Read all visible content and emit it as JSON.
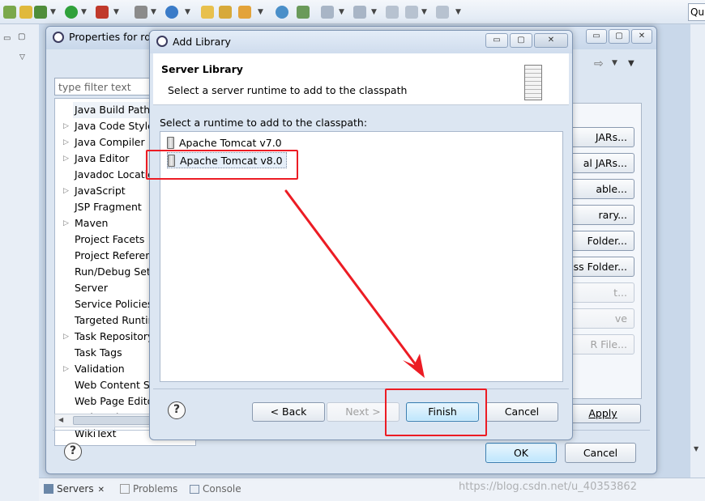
{
  "app": {
    "quick_access": "Quick Access"
  },
  "bottom_tabs": [
    {
      "label": "Servers",
      "icon": "servers-icon"
    },
    {
      "label": "Problems",
      "icon": "problems-icon"
    },
    {
      "label": "Console",
      "icon": "console-icon"
    }
  ],
  "properties": {
    "title": "Properties for rdb",
    "filter_placeholder": "type filter text",
    "tree_items": [
      {
        "label": "Java Build Path",
        "expandable": false,
        "selected": true
      },
      {
        "label": "Java Code Style",
        "expandable": true
      },
      {
        "label": "Java Compiler",
        "expandable": true
      },
      {
        "label": "Java Editor",
        "expandable": true
      },
      {
        "label": "Javadoc Location",
        "expandable": false
      },
      {
        "label": "JavaScript",
        "expandable": true
      },
      {
        "label": "JSP Fragment",
        "expandable": false
      },
      {
        "label": "Maven",
        "expandable": true
      },
      {
        "label": "Project Facets",
        "expandable": false
      },
      {
        "label": "Project References",
        "expandable": false
      },
      {
        "label": "Run/Debug Settings",
        "expandable": false
      },
      {
        "label": "Server",
        "expandable": false
      },
      {
        "label": "Service Policies",
        "expandable": false
      },
      {
        "label": "Targeted Runtimes",
        "expandable": false
      },
      {
        "label": "Task Repository",
        "expandable": true
      },
      {
        "label": "Task Tags",
        "expandable": false
      },
      {
        "label": "Validation",
        "expandable": true
      },
      {
        "label": "Web Content Settings",
        "expandable": false
      },
      {
        "label": "Web Page Editor",
        "expandable": false
      },
      {
        "label": "Web Project Settings",
        "expandable": false
      },
      {
        "label": "WikiText",
        "expandable": false
      }
    ],
    "right_buttons": [
      {
        "label": "JARs...",
        "enabled": true
      },
      {
        "label": "al JARs...",
        "enabled": true
      },
      {
        "label": "able...",
        "enabled": true
      },
      {
        "label": "rary...",
        "enabled": true
      },
      {
        "label": "Folder...",
        "enabled": true
      },
      {
        "label": "ass Folder...",
        "enabled": true
      },
      {
        "label": "t...",
        "enabled": false
      },
      {
        "label": "ve",
        "enabled": false
      },
      {
        "label": "R File...",
        "enabled": false
      }
    ],
    "apply_label": "Apply",
    "ok_label": "OK",
    "cancel_label": "Cancel"
  },
  "dialog": {
    "title": "Add Library",
    "header_title": "Server Library",
    "header_desc": "Select a server runtime to add to the classpath",
    "list_label": "Select a runtime to add to the classpath:",
    "runtimes": [
      {
        "label": "Apache Tomcat v7.0",
        "selected": false
      },
      {
        "label": "Apache Tomcat v8.0",
        "selected": true
      }
    ],
    "back_label": "< Back",
    "next_label": "Next >",
    "finish_label": "Finish",
    "cancel_label": "Cancel"
  },
  "watermark": "https://blog.csdn.net/u_40353862",
  "colors": {
    "annotation_red": "#ec1c24",
    "selection": "#cce8ff",
    "default_button": "#bee6fd"
  }
}
